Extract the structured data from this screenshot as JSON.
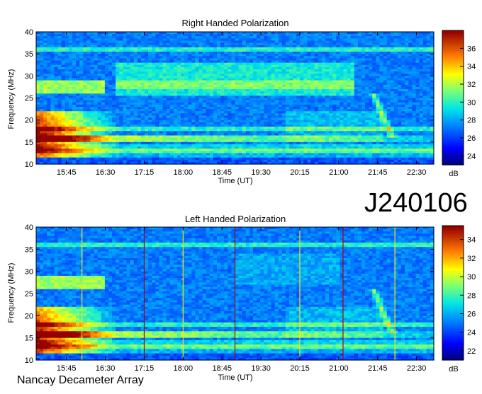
{
  "page": {
    "observation_id": "J240106",
    "footer": "Nancay Decameter Array"
  },
  "chart_data": [
    {
      "type": "heatmap",
      "title": "Right Handed Polarization",
      "xlabel": "Time (UT)",
      "ylabel": "Frequency (MHz)",
      "x_ticks": [
        "15:45",
        "16:30",
        "17:15",
        "18:00",
        "18:45",
        "19:30",
        "20:15",
        "21:00",
        "21:45",
        "22:30"
      ],
      "y_ticks": [
        10,
        15,
        20,
        25,
        30,
        35,
        40
      ],
      "ylim": [
        10,
        40
      ],
      "colorbar": {
        "label": "dB",
        "ticks": [
          24,
          26,
          28,
          30,
          32,
          34,
          36
        ],
        "range": [
          23,
          38
        ]
      },
      "features": {
        "strong_emission_band_mhz": [
          12,
          22
        ],
        "strong_emission_time_end": "16:45",
        "diffuse_arc_band_mhz": [
          26,
          34
        ],
        "drifting_burst_time": "21:40",
        "drifting_burst_band_mhz": [
          17,
          26
        ]
      }
    },
    {
      "type": "heatmap",
      "title": "Left Handed Polarization",
      "xlabel": "Time (UT)",
      "ylabel": "Frequency (MHz)",
      "x_ticks": [
        "15:45",
        "16:30",
        "17:15",
        "18:00",
        "18:45",
        "19:30",
        "20:15",
        "21:00",
        "21:45",
        "22:30"
      ],
      "y_ticks": [
        10,
        15,
        20,
        25,
        30,
        35,
        40
      ],
      "ylim": [
        10,
        40
      ],
      "colorbar": {
        "label": "dB",
        "ticks": [
          22,
          24,
          26,
          28,
          30,
          32,
          34
        ],
        "range": [
          21,
          35.5
        ]
      },
      "features": {
        "strong_emission_band_mhz": [
          12,
          22
        ],
        "strong_emission_time_end": "16:45",
        "drifting_burst_time": "21:40",
        "drifting_burst_band_mhz": [
          15,
          26
        ],
        "vertical_interference_times": [
          "16:03",
          "17:15",
          "18:00",
          "19:00",
          "20:15",
          "21:05",
          "22:05"
        ]
      }
    }
  ]
}
